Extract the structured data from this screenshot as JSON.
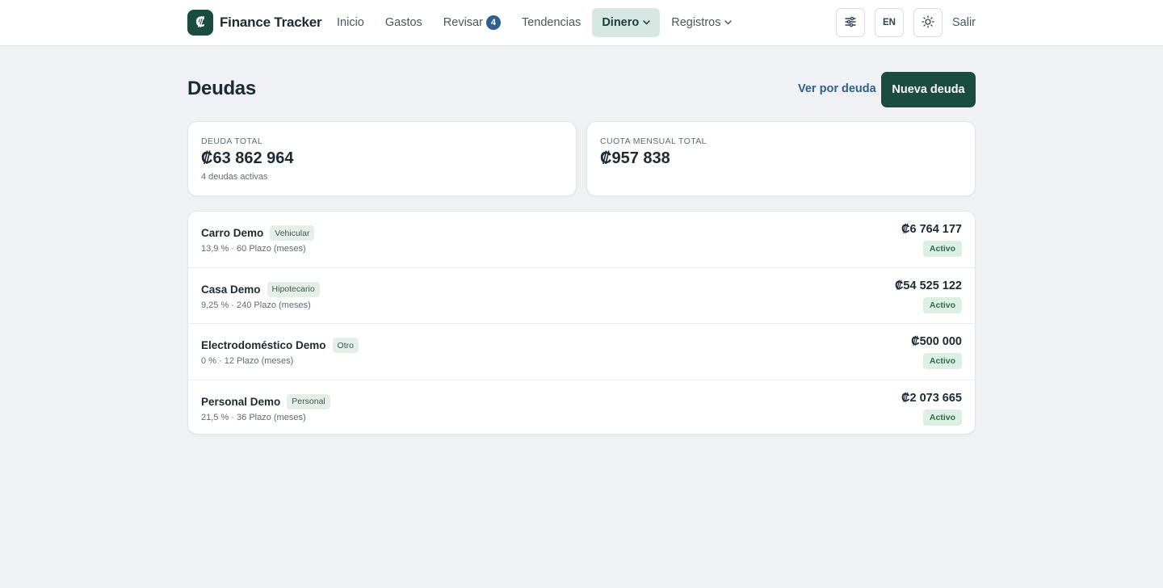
{
  "brand": {
    "name": "Finance Tracker",
    "logo_glyph": "₡"
  },
  "nav": {
    "items": [
      {
        "label": "Inicio"
      },
      {
        "label": "Gastos"
      },
      {
        "label": "Revisar",
        "badge": "4"
      },
      {
        "label": "Tendencias"
      },
      {
        "label": "Dinero",
        "active": true,
        "dropdown": true
      },
      {
        "label": "Registros",
        "dropdown": true
      }
    ],
    "lang_label": "EN",
    "logout_label": "Salir"
  },
  "page": {
    "title": "Deudas",
    "view_link": "Ver por deuda",
    "new_button": "Nueva deuda"
  },
  "summary": {
    "total_debt": {
      "label": "DEUDA TOTAL",
      "value": "₡63 862 964",
      "sub": "4 deudas activas"
    },
    "monthly": {
      "label": "CUOTA MENSUAL TOTAL",
      "value": "₡957 838"
    }
  },
  "debts": [
    {
      "name": "Carro Demo",
      "type": "Vehicular",
      "meta": "13,9 % · 60 Plazo (meses)",
      "amount": "₡6 764 177",
      "status": "Activo"
    },
    {
      "name": "Casa Demo",
      "type": "Hipotecario",
      "meta": "9,25 % · 240 Plazo (meses)",
      "amount": "₡54 525 122",
      "status": "Activo"
    },
    {
      "name": "Electrodoméstico Demo",
      "type": "Otro",
      "meta": "0 % · 12 Plazo (meses)",
      "amount": "₡500 000",
      "status": "Activo"
    },
    {
      "name": "Personal Demo",
      "type": "Personal",
      "meta": "21,5 % · 36 Plazo (meses)",
      "amount": "₡2 073 665",
      "status": "Activo"
    }
  ],
  "icons": {
    "settings": "sliders-icon",
    "theme": "sun-icon",
    "chevron": "chevron-down-icon"
  },
  "colors": {
    "brand": "#1a4d40",
    "link": "#2d5f8f",
    "active_nav_bg": "#d7e8e2",
    "status_bg": "#dcefe4"
  }
}
